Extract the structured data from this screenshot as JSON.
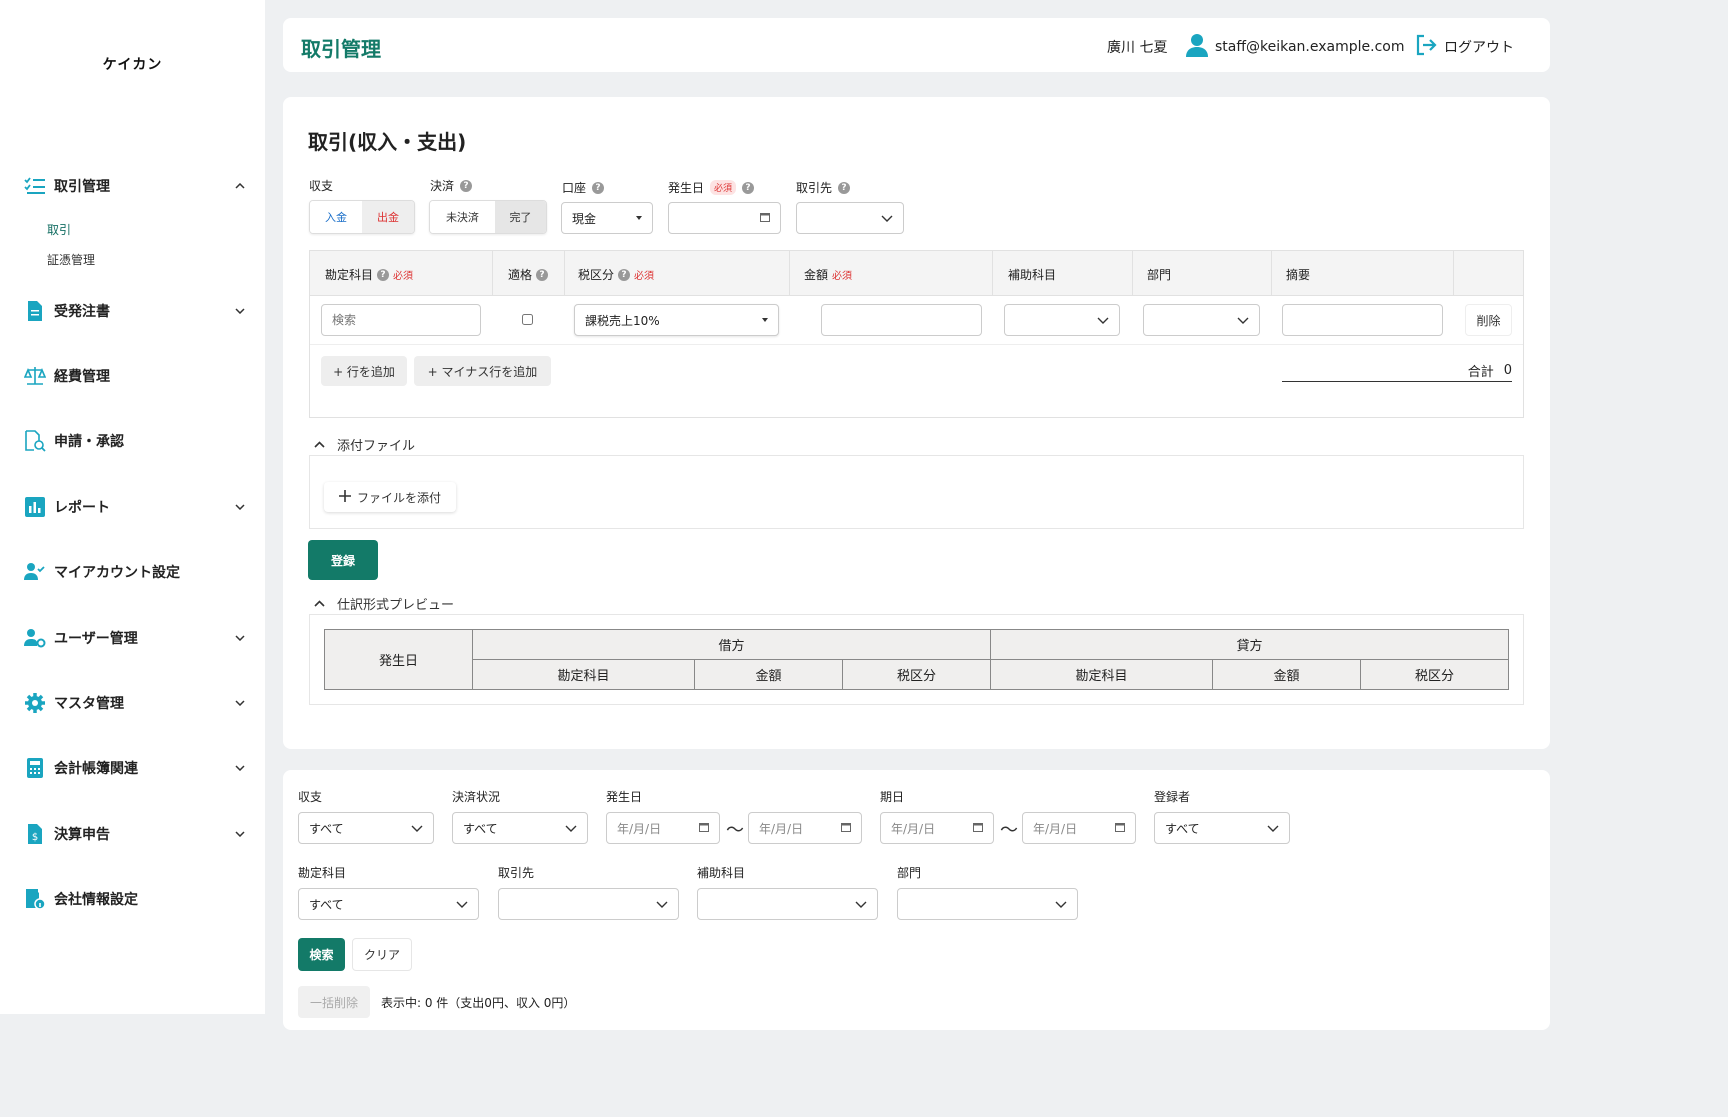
{
  "app": {
    "logo": "ケイカン"
  },
  "sidebar": {
    "items": [
      {
        "label": "取引管理",
        "icon": "checklist-icon",
        "expanded": true
      },
      {
        "label": "受発注書",
        "icon": "document-icon"
      },
      {
        "label": "経費管理",
        "icon": "scale-icon"
      },
      {
        "label": "申請・承認",
        "icon": "document-search-icon"
      },
      {
        "label": "レポート",
        "icon": "bar-chart-icon"
      },
      {
        "label": "マイアカウント設定",
        "icon": "user-check-icon"
      },
      {
        "label": "ユーザー管理",
        "icon": "user-gear-icon"
      },
      {
        "label": "マスタ管理",
        "icon": "gear-icon"
      },
      {
        "label": "会計帳簿関連",
        "icon": "calculator-icon"
      },
      {
        "label": "決算申告",
        "icon": "yen-document-icon"
      },
      {
        "label": "会社情報設定",
        "icon": "company-info-icon"
      }
    ],
    "sub": [
      {
        "label": "取引",
        "active": true
      },
      {
        "label": "証憑管理"
      }
    ]
  },
  "header": {
    "title": "取引管理",
    "user_name": "廣川 七夏",
    "email": "staff@keikan.example.com",
    "logout": "ログアウト"
  },
  "form": {
    "title": "取引(収入・支出)",
    "labels": {
      "income_expense": "収支",
      "settlement": "決済",
      "account": "口座",
      "date": "発生日",
      "partner": "取引先"
    },
    "required": "必須",
    "income_expense": {
      "options": [
        "入金",
        "出金"
      ],
      "selected": "出金"
    },
    "settlement": {
      "options": [
        "未決済",
        "完了"
      ],
      "selected": "完了"
    },
    "account_value": "現金",
    "table": {
      "headers": [
        "勘定科目",
        "適格",
        "税区分",
        "金額",
        "補助科目",
        "部門",
        "摘要"
      ],
      "row": {
        "account_placeholder": "検索",
        "tax_value": "課税売上10%",
        "delete": "削除"
      },
      "add_row": "+ 行を追加",
      "add_minus_row": "+ マイナス行を追加",
      "total_label": "合計",
      "total_value": "0"
    },
    "attachments": {
      "title": "添付ファイル",
      "add": "ファイルを添付"
    },
    "submit": "登録",
    "preview": {
      "title": "仕訳形式プレビュー",
      "date": "発生日",
      "debit": "借方",
      "credit": "貸方",
      "cols": [
        "勘定科目",
        "金額",
        "税区分"
      ]
    }
  },
  "filters": {
    "labels": {
      "income_expense": "収支",
      "settlement_status": "決済状況",
      "date": "発生日",
      "due": "期日",
      "registrant": "登録者",
      "account": "勘定科目",
      "partner": "取引先",
      "sub_account": "補助科目",
      "department": "部門"
    },
    "all": "すべて",
    "date_placeholder": "年/月/日",
    "search": "検索",
    "clear": "クリア",
    "bulk_delete": "一括削除",
    "status_text": "表示中: 0 件（支出0円、収入 0円）"
  }
}
